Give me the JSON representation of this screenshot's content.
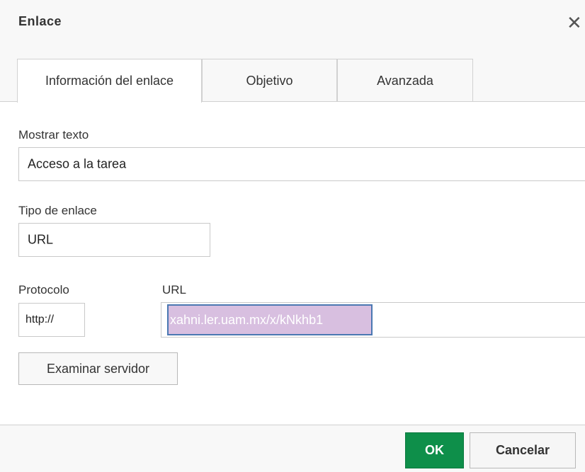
{
  "dialog": {
    "title": "Enlace",
    "close_label": "✕"
  },
  "tabs": [
    {
      "label": "Información del enlace",
      "active": true
    },
    {
      "label": "Objetivo",
      "active": false
    },
    {
      "label": "Avanzada",
      "active": false
    }
  ],
  "form": {
    "display_text": {
      "label": "Mostrar texto",
      "value": "Acceso a la tarea"
    },
    "link_type": {
      "label": "Tipo de enlace",
      "value": "URL"
    },
    "protocol": {
      "label": "Protocolo",
      "value": "http://"
    },
    "url": {
      "label": "URL",
      "value": "xahni.ler.uam.mx/x/kNkhb1"
    },
    "browse_label": "Examinar servidor"
  },
  "footer": {
    "ok_label": "OK",
    "cancel_label": "Cancelar"
  },
  "colors": {
    "ok_button": "#0e8f4a",
    "selection_highlight": "#d8bfe0",
    "selection_border": "#4a78b2"
  }
}
